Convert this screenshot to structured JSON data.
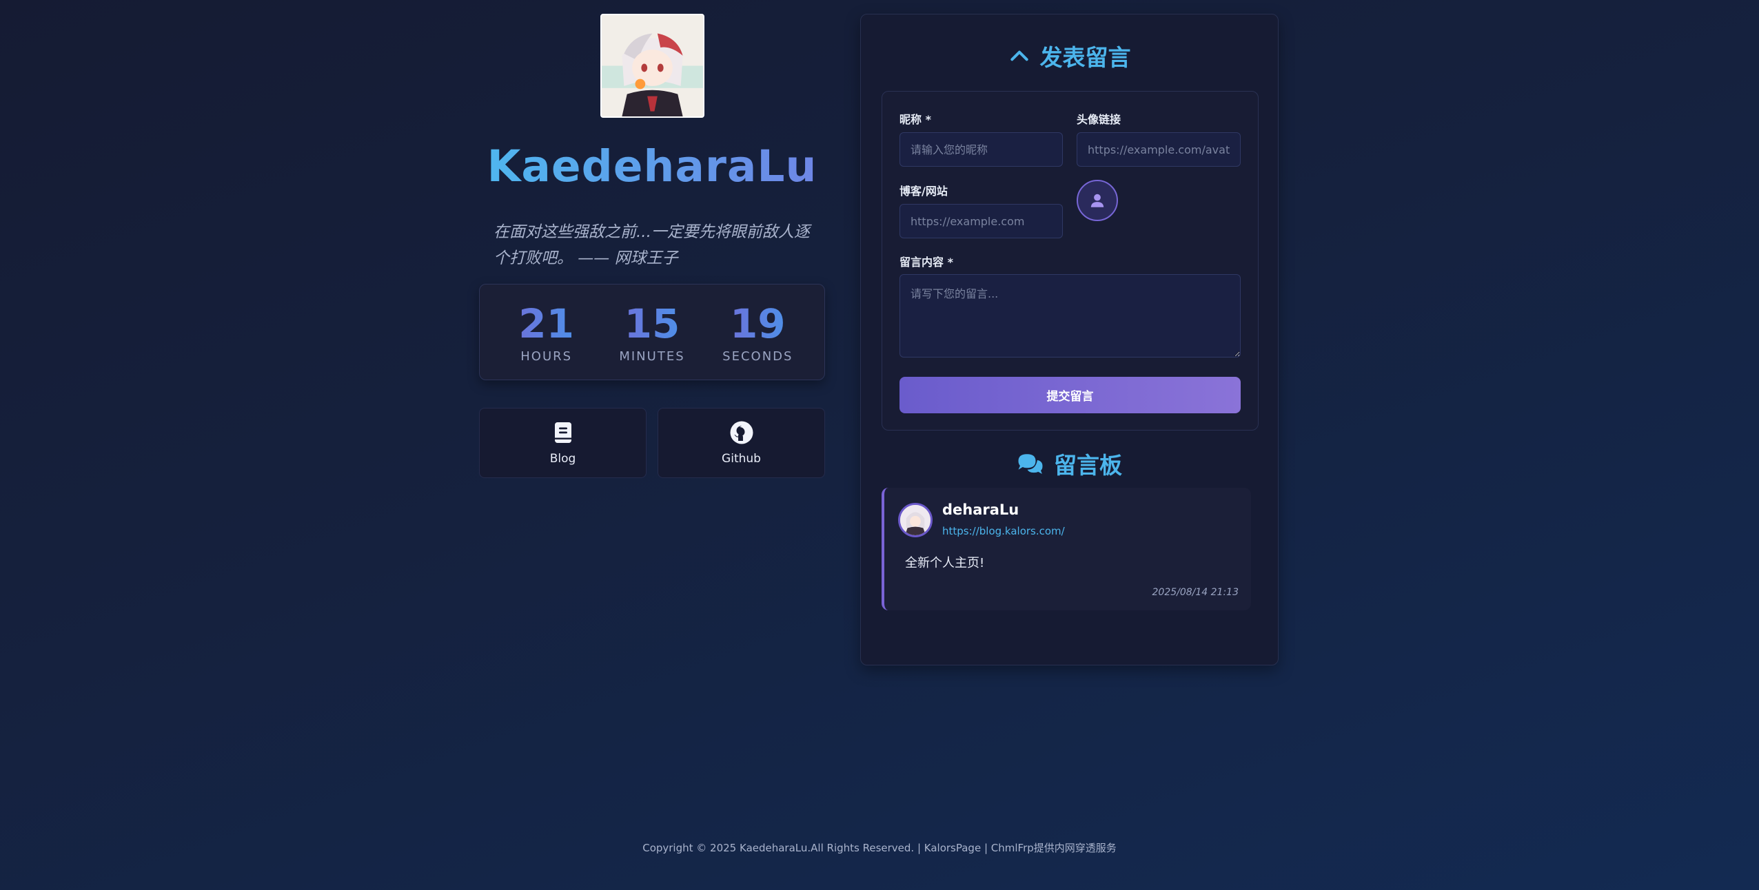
{
  "profile": {
    "name": "KaedeharaLu",
    "motto": "在面对这些强敌之前...一定要先将眼前敌人逐个打败吧。 —— 网球王子",
    "avatar_alt": "avatar"
  },
  "countdown": {
    "hours": "21",
    "hours_label": "HOURS",
    "minutes": "15",
    "minutes_label": "MINUTES",
    "seconds": "19",
    "seconds_label": "SECONDS"
  },
  "links": [
    {
      "label": "Blog",
      "icon": "book-icon"
    },
    {
      "label": "Github",
      "icon": "github-icon"
    }
  ],
  "guestbook": {
    "form_title": "发表留言",
    "nickname_label": "昵称 *",
    "nickname_placeholder": "请输入您的昵称",
    "avatar_label": "头像链接",
    "avatar_placeholder": "https://example.com/avatar",
    "website_label": "博客/网站",
    "website_placeholder": "https://example.com",
    "content_label": "留言内容 *",
    "content_placeholder": "请写下您的留言...",
    "submit_label": "提交留言",
    "board_title": "留言板"
  },
  "messages": [
    {
      "name": "deharaLu",
      "url": "https://blog.kalors.com/",
      "text": "全新个人主页!",
      "time": "2025/08/14 21:13"
    }
  ],
  "footer": {
    "text": "Copyright © 2025 KaedeharaLu.All Rights Reserved. | KalorsPage | ChmlFrp提供内网穿透服务"
  },
  "colors": {
    "accent_blue": "#4cb5ec",
    "accent_purple": "#7a63d6",
    "background": "#15213e"
  }
}
